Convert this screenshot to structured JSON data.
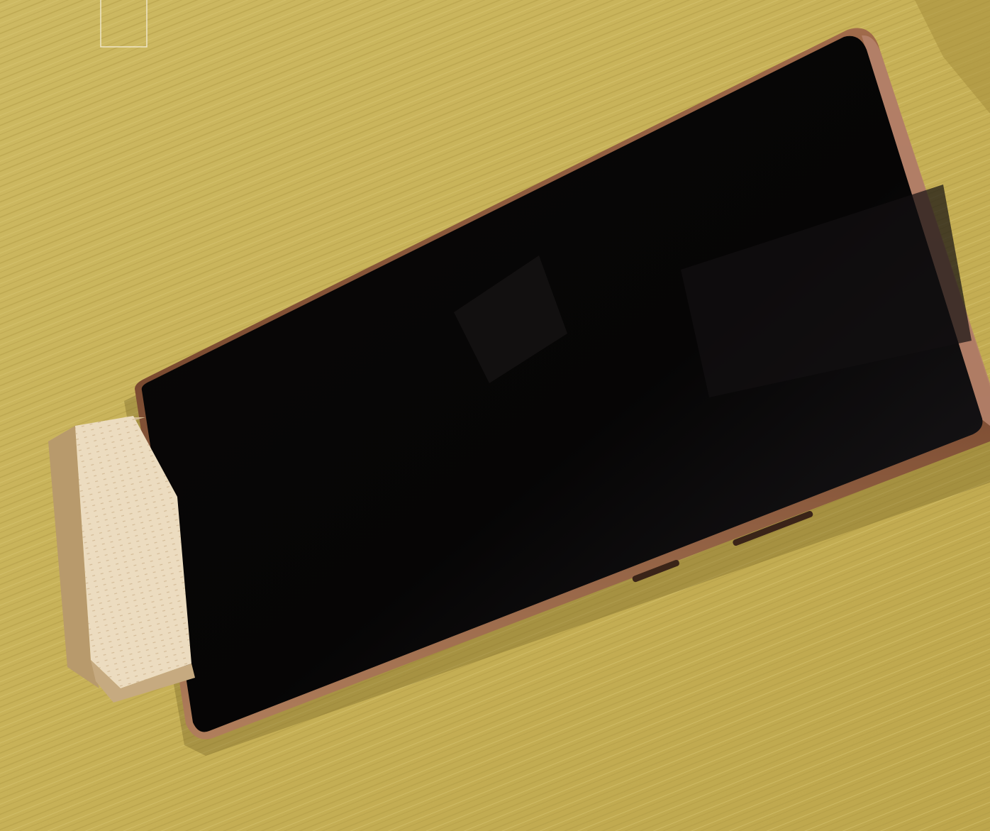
{
  "scene": {
    "subject": "smartphone-on-wooden-block",
    "colors": {
      "table": "#c9b45a",
      "table_light": "#d9c56c",
      "table_dark": "#a8923e",
      "phone_frame": "#8a5a3a",
      "phone_frame_highlight": "#c08a6a",
      "screen": "#050404",
      "wood_block_face": "#ecdcc0",
      "wood_block_side": "#bfa37a",
      "wood_block_end": "#d8c29c"
    }
  }
}
